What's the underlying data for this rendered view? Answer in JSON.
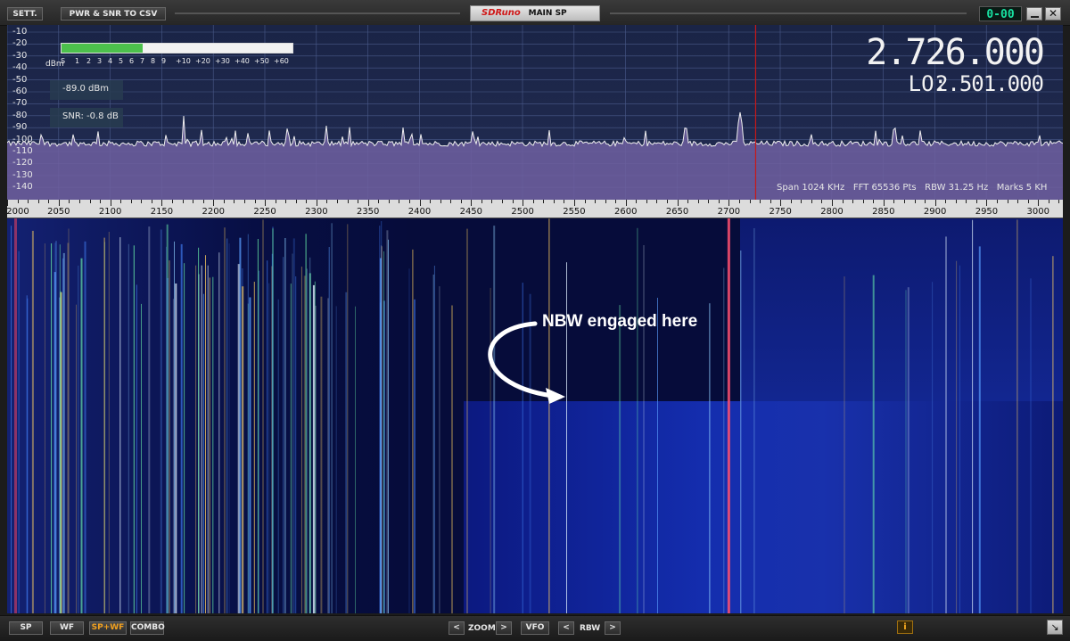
{
  "toolbar": {
    "settings_label": "SETT.",
    "export_label": "PWR & SNR TO CSV",
    "brand": "SDRuno",
    "window_title": "MAIN SP",
    "lcd_readout": "0-00"
  },
  "spectrum": {
    "unit": "dBm",
    "y_labels": [
      "-10",
      "-20",
      "-30",
      "-40",
      "-50",
      "-60",
      "-70",
      "-80",
      "-90",
      "-100",
      "-110",
      "-120",
      "-130",
      "-140"
    ],
    "s_scale": [
      "S",
      "1",
      "2",
      "3",
      "4",
      "5",
      "6",
      "7",
      "8",
      "9",
      "+10",
      "+20",
      "+30",
      "+40",
      "+50",
      "+60"
    ],
    "smeter_level": 0.35,
    "power_readout": "-89.0 dBm",
    "snr_readout": "SNR: -0.8 dB",
    "frequency": "2.726.000",
    "lo_label": "LO:",
    "lo_frequency": "2.501.000",
    "span_info": "Span 1024 KHz   FFT 65536 Pts   RBW 31.25 Hz   Marks 5 KH",
    "x_labels": [
      "2000",
      "2050",
      "2100",
      "2150",
      "2200",
      "2250",
      "2300",
      "2350",
      "2400",
      "2450",
      "2500",
      "2550",
      "2600",
      "2650",
      "2700",
      "2750",
      "2800",
      "2850",
      "2900",
      "2950",
      "3000"
    ],
    "colors": {
      "trace": "#e8e8e8",
      "fill": "#7a6aa8",
      "marker": "#c81818",
      "grid": "#4a5a8a"
    }
  },
  "waterfall": {
    "annotation": "NBW engaged here"
  },
  "bottom": {
    "sp": "SP",
    "wf": "WF",
    "spwf": "SP+WF",
    "combo": "COMBO",
    "zoom": "ZOOM",
    "vfo": "VFO",
    "rbw": "RBW",
    "prev": "<",
    "next": ">",
    "info": "i"
  }
}
